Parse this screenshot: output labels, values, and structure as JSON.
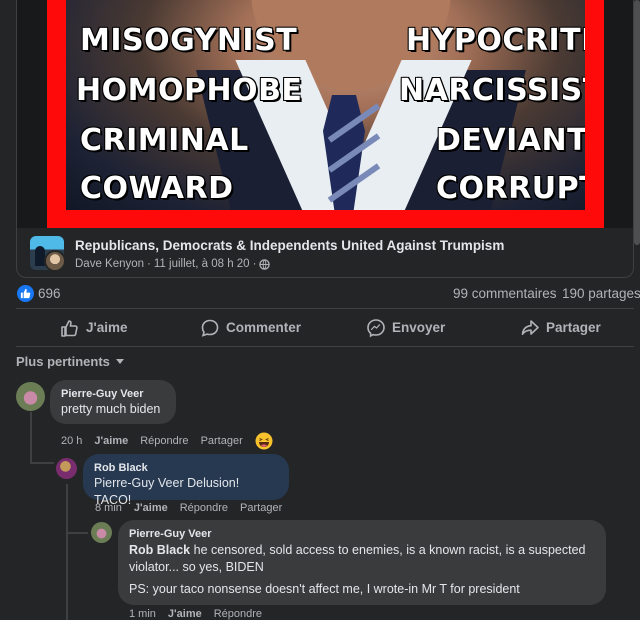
{
  "shared_post": {
    "meme_words_left": [
      "MISOGYNIST",
      "HOMOPHOBE",
      "CRIMINAL",
      "COWARD"
    ],
    "meme_words_right": [
      "HYPOCRITE",
      "NARCISSIST",
      "DEVIANT",
      "CORRUPT"
    ],
    "group_name": "Republicans, Democrats & Independents United Against Trumpism",
    "author": "Dave Kenyon",
    "date": "11 juillet, à 08 h 20",
    "privacy_icon": "globe-icon"
  },
  "stats": {
    "reactions": "696",
    "comments": "99 commentaires",
    "shares": "190 partages"
  },
  "actions": {
    "like": "J'aime",
    "comment": "Commenter",
    "send": "Envoyer",
    "share": "Partager"
  },
  "sort": {
    "label": "Plus pertinents"
  },
  "comments": [
    {
      "author": "Pierre-Guy Veer",
      "text": "pretty much biden",
      "time": "20 h",
      "like": "J'aime",
      "reply": "Répondre",
      "share": "Partager",
      "reaction_icon": "laughing-emoji-icon"
    },
    {
      "author": "Rob Black",
      "text": "Pierre-Guy Veer Delusion! TACO!",
      "time": "8 min",
      "like": "J'aime",
      "reply": "Répondre",
      "share": "Partager"
    },
    {
      "author": "Pierre-Guy Veer",
      "tag": "Rob Black",
      "text_line1": " he censored, sold access to enemies, is a known racist, is a suspected",
      "text_line2": "violator... so yes, BIDEN",
      "text_line3": "PS: your taco nonsense doesn't affect me, I wrote-in Mr T for president",
      "time": "1 min",
      "like": "J'aime",
      "reply": "Répondre"
    }
  ],
  "colors": {
    "background": "#242526",
    "bubble": "#3a3b3c",
    "highlight_bubble": "#263951",
    "accent": "#1877f2",
    "meme_border": "#ff0a0a"
  }
}
